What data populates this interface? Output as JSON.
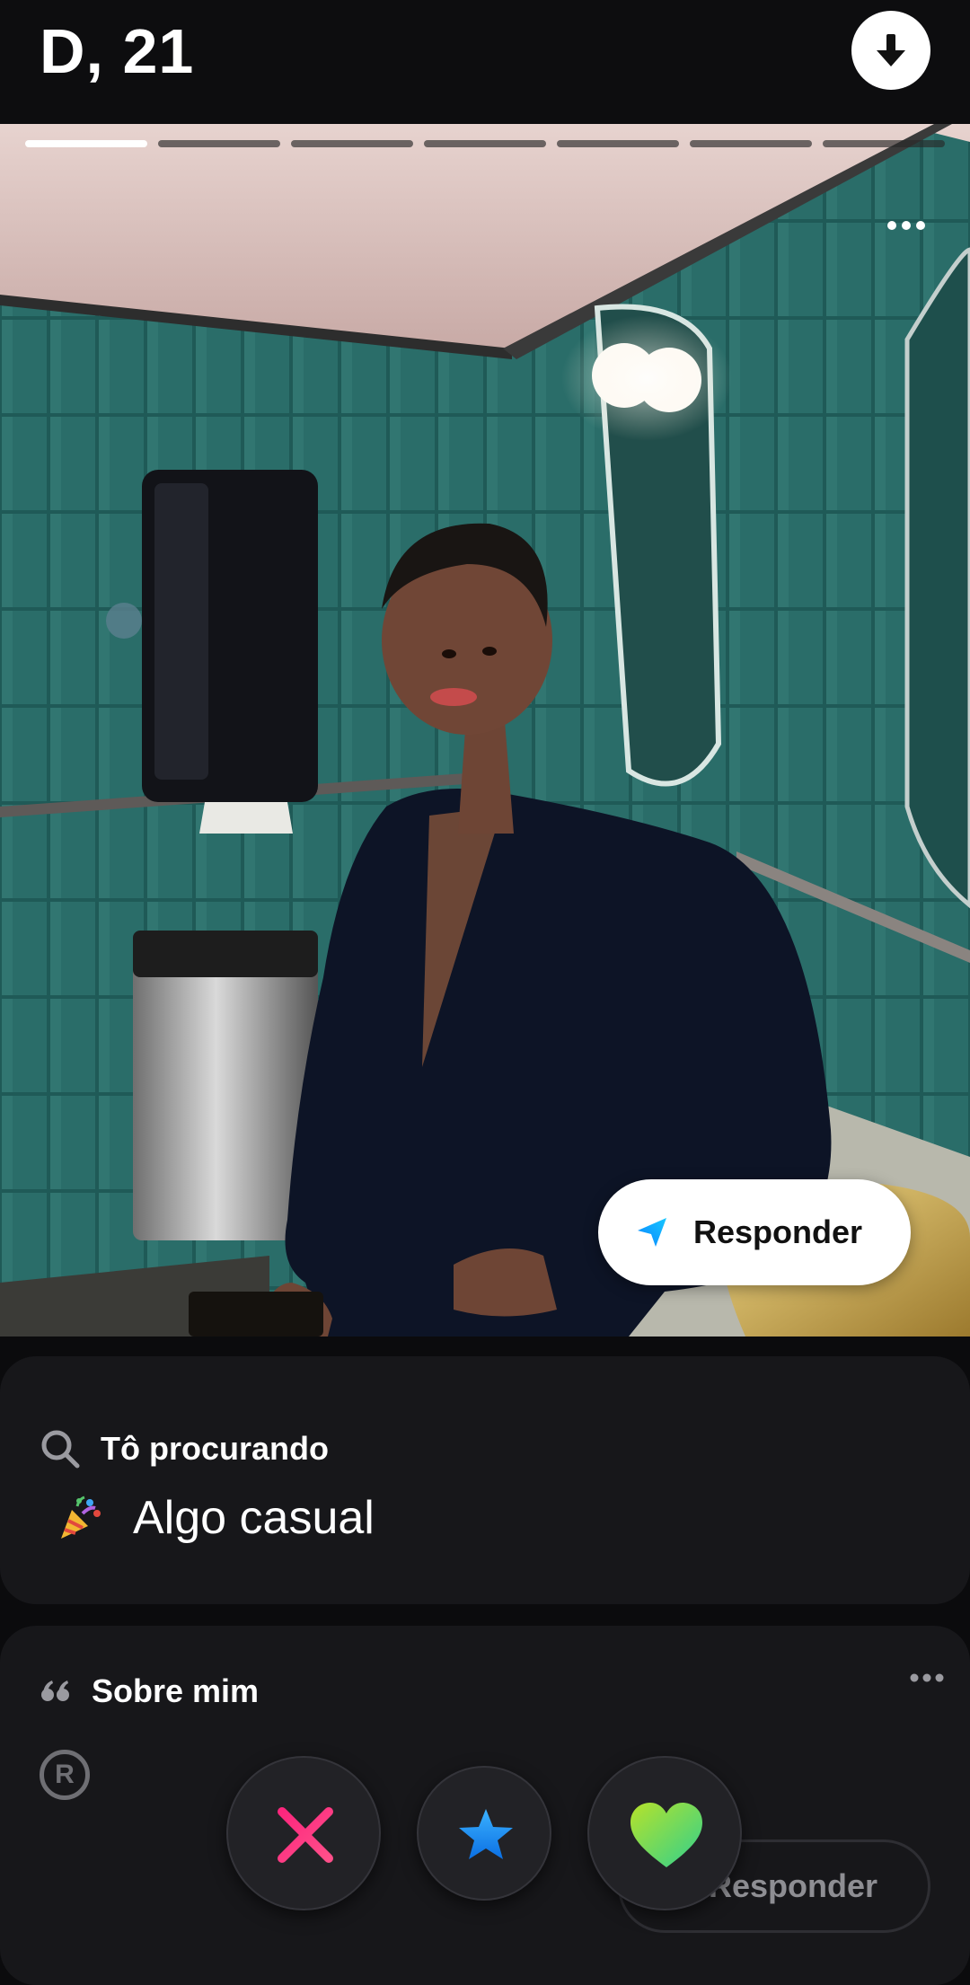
{
  "header": {
    "name_age": "D, 21"
  },
  "photo": {
    "total_photos": 7,
    "active_photo": 1,
    "reply_label": "Responder"
  },
  "looking_for": {
    "title": "Tô procurando",
    "value": "Algo casual"
  },
  "about": {
    "title": "Sobre mim",
    "registered_mark": "R",
    "reply_label": "Responder"
  },
  "colors": {
    "background": "#0b0b0d",
    "card": "#17171a",
    "nope": "#fd2d7c",
    "star": "#1e90ff",
    "like_start": "#2fe08f",
    "like_end": "#b6e22a"
  },
  "icons": {
    "download": "download-arrow-icon",
    "more": "more-dots-icon",
    "send": "send-arrow-icon",
    "search": "search-icon",
    "party": "party-popper-icon",
    "quote": "quote-icon",
    "nope": "x-icon",
    "star": "star-icon",
    "like": "heart-icon"
  }
}
